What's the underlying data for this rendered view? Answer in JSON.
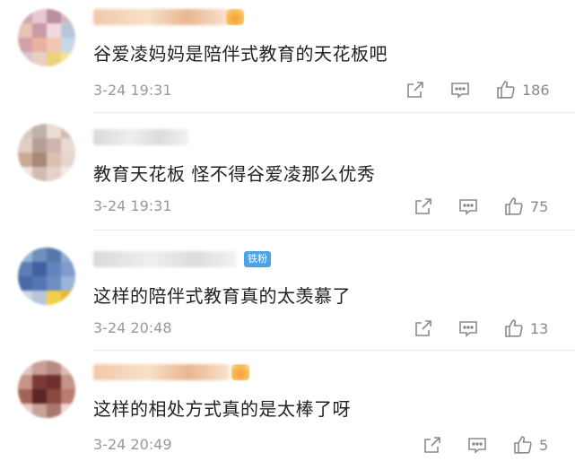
{
  "comments": [
    {
      "text": "谷爱凌妈妈是陪伴式教育的天花板吧",
      "time": "3-24 19:31",
      "likes": "186",
      "avatar_colors": [
        "#cfa9b1",
        "#e6c8cf",
        "#b98ea0",
        "#d6b7c1",
        "#e7c3b4",
        "#ca9aa8",
        "#f0d8e0",
        "#b7c7d9",
        "#d4a1aa",
        "#e9b2a0",
        "#f2c6b4",
        "#c6d7e8",
        "#dbc4cf",
        "#e8d0c0",
        "#ead37a",
        "#f3e3a0"
      ]
    },
    {
      "text": "教育天花板 怪不得谷爱凌那么优秀",
      "time": "3-24 19:31",
      "likes": "75",
      "avatar_colors": [
        "#d9c8c2",
        "#c2b0ab",
        "#ecdcd3",
        "#d0bdb6",
        "#e0cdc5",
        "#b79f98",
        "#cdb6ad",
        "#e8d9d2",
        "#caa995",
        "#a88977",
        "#d9c0b0",
        "#e7d6cd",
        "#f0e6e0",
        "#d1bcb0",
        "#e4d2c8",
        "#f3ebe6"
      ]
    },
    {
      "text": "这样的陪伴式教育真的太羡慕了",
      "time": "3-24 20:48",
      "likes": "13",
      "fan_badge": "铁粉",
      "avatar_colors": [
        "#9ab3d6",
        "#6f8fbd",
        "#5777ad",
        "#8ca9d0",
        "#5c7db4",
        "#3f61a0",
        "#6384bc",
        "#7f9dca",
        "#4a6aa6",
        "#5576b0",
        "#6e8ec0",
        "#9bb4d8",
        "#cfd7e3",
        "#b9c6da",
        "#f2cf4c",
        "#e8b93b"
      ]
    },
    {
      "text": "这样的相处方式真的是太棒了呀",
      "time": "3-24 20:49",
      "likes": "5",
      "avatar_colors": [
        "#e2c4bd",
        "#c99f95",
        "#b98a82",
        "#dcbcb4",
        "#c89488",
        "#7a3b36",
        "#6e2f2d",
        "#c39488",
        "#a36358",
        "#5b2624",
        "#8a4840",
        "#b97c70",
        "#e7cfc8",
        "#c6a49a",
        "#a8786e",
        "#efd8d2"
      ]
    }
  ],
  "icons": {
    "share": "share-icon",
    "reply": "comment-icon",
    "like": "thumbs-up-icon"
  }
}
